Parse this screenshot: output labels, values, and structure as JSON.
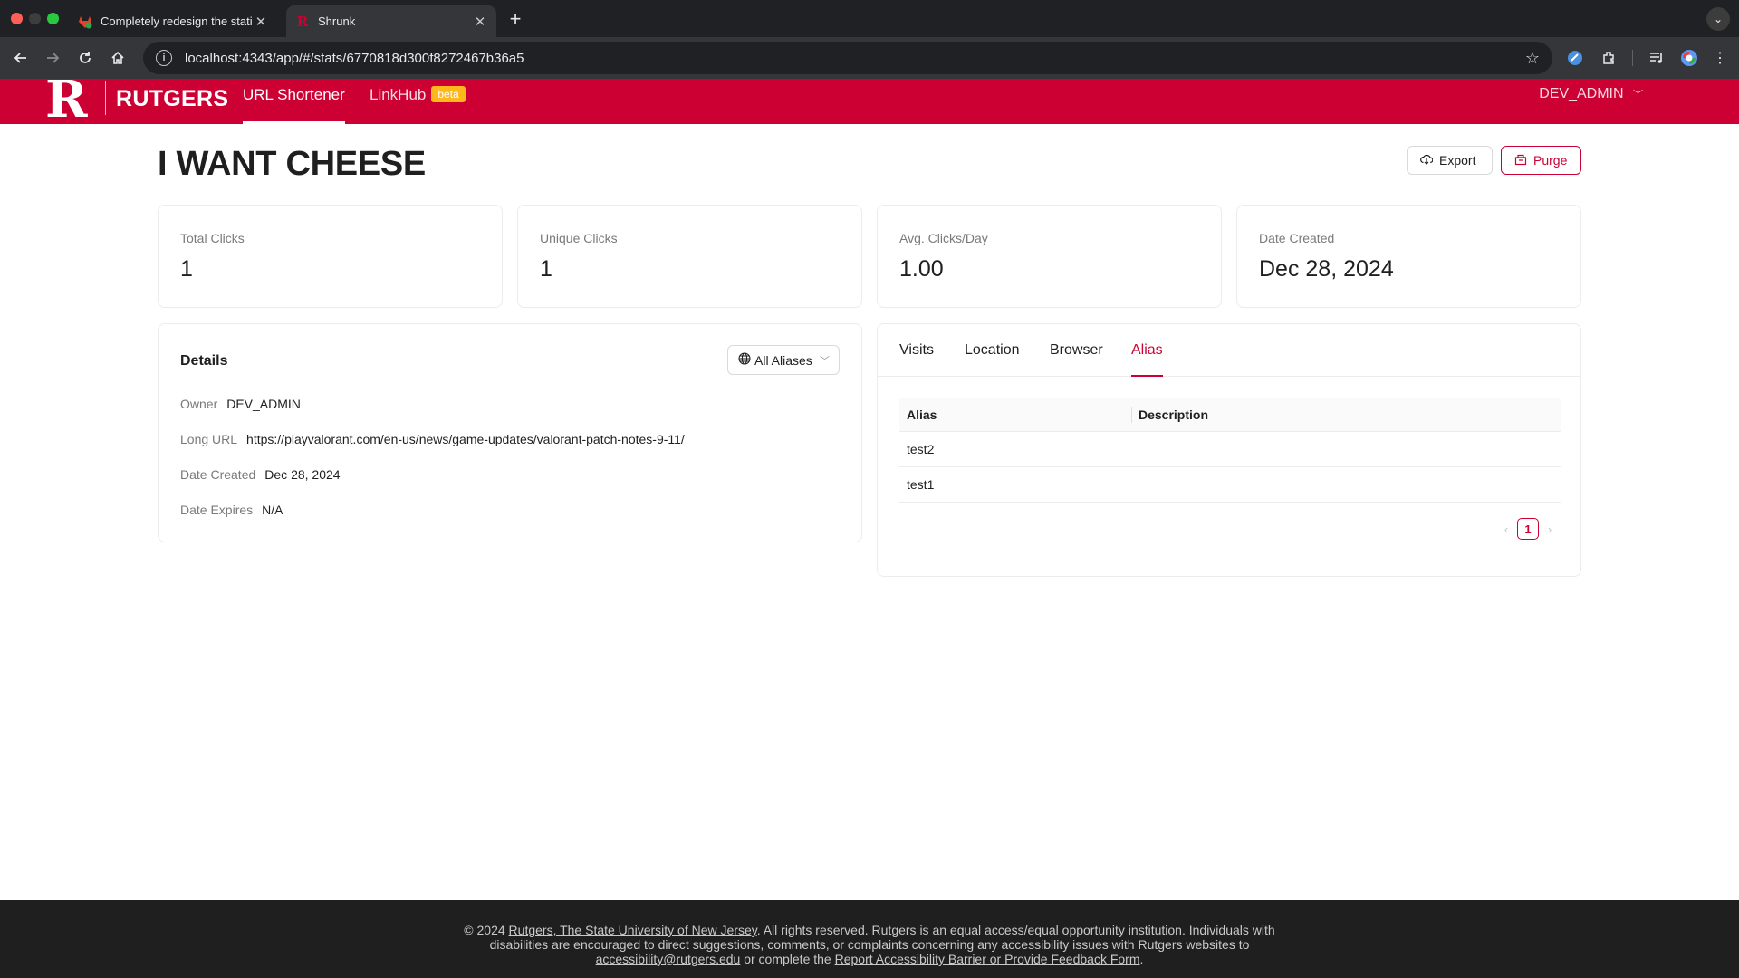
{
  "browser": {
    "tabs": [
      {
        "title": "Completely redesign the stati",
        "active": false
      },
      {
        "title": "Shrunk",
        "active": true
      }
    ],
    "url": "localhost:4343/app/#/stats/6770818d300f8272467b36a5",
    "icons": [
      "back-icon",
      "forward-icon",
      "reload-icon",
      "home-icon",
      "site-info-icon",
      "bookmark-star-icon",
      "extension-icon",
      "media-icon",
      "profile-icon",
      "menu-icon"
    ]
  },
  "header": {
    "logo_text": "RUTGERS",
    "nav": [
      {
        "label": "URL Shortener",
        "active": true
      },
      {
        "label": "LinkHub",
        "badge": "beta",
        "active": false
      }
    ],
    "user": "DEV_ADMIN",
    "brand_color": "#cc0033"
  },
  "page": {
    "title": "I WANT CHEESE",
    "export_label": "Export",
    "purge_label": "Purge"
  },
  "stats": [
    {
      "label": "Total Clicks",
      "value": "1"
    },
    {
      "label": "Unique Clicks",
      "value": "1"
    },
    {
      "label": "Avg. Clicks/Day",
      "value": "1.00"
    },
    {
      "label": "Date Created",
      "value": "Dec 28, 2024"
    }
  ],
  "details": {
    "title": "Details",
    "alias_filter": "All Aliases",
    "rows": [
      {
        "key": "Owner",
        "value": "DEV_ADMIN"
      },
      {
        "key": "Long URL",
        "value": "https://playvalorant.com/en-us/news/game-updates/valorant-patch-notes-9-11/"
      },
      {
        "key": "Date Created",
        "value": "Dec 28, 2024"
      },
      {
        "key": "Date Expires",
        "value": "N/A"
      }
    ]
  },
  "analytics": {
    "tabs": [
      "Visits",
      "Location",
      "Browser",
      "Alias"
    ],
    "active_tab": "Alias",
    "table": {
      "columns": [
        "Alias",
        "Description"
      ],
      "rows": [
        {
          "alias": "test2",
          "description": ""
        },
        {
          "alias": "test1",
          "description": ""
        }
      ]
    },
    "page": "1"
  },
  "footer": {
    "prefix": "© 2024 ",
    "org_link": "Rutgers, The State University of New Jersey",
    "text1": ". All rights reserved. Rutgers is an equal access/equal opportunity institution. Individuals with disabilities are encouraged to direct suggestions, comments, or complaints concerning any accessibility issues with Rutgers websites to ",
    "email_link": "accessibility@rutgers.edu",
    "text2": " or complete the ",
    "form_link": "Report Accessibility Barrier or Provide Feedback Form",
    "suffix": "."
  }
}
